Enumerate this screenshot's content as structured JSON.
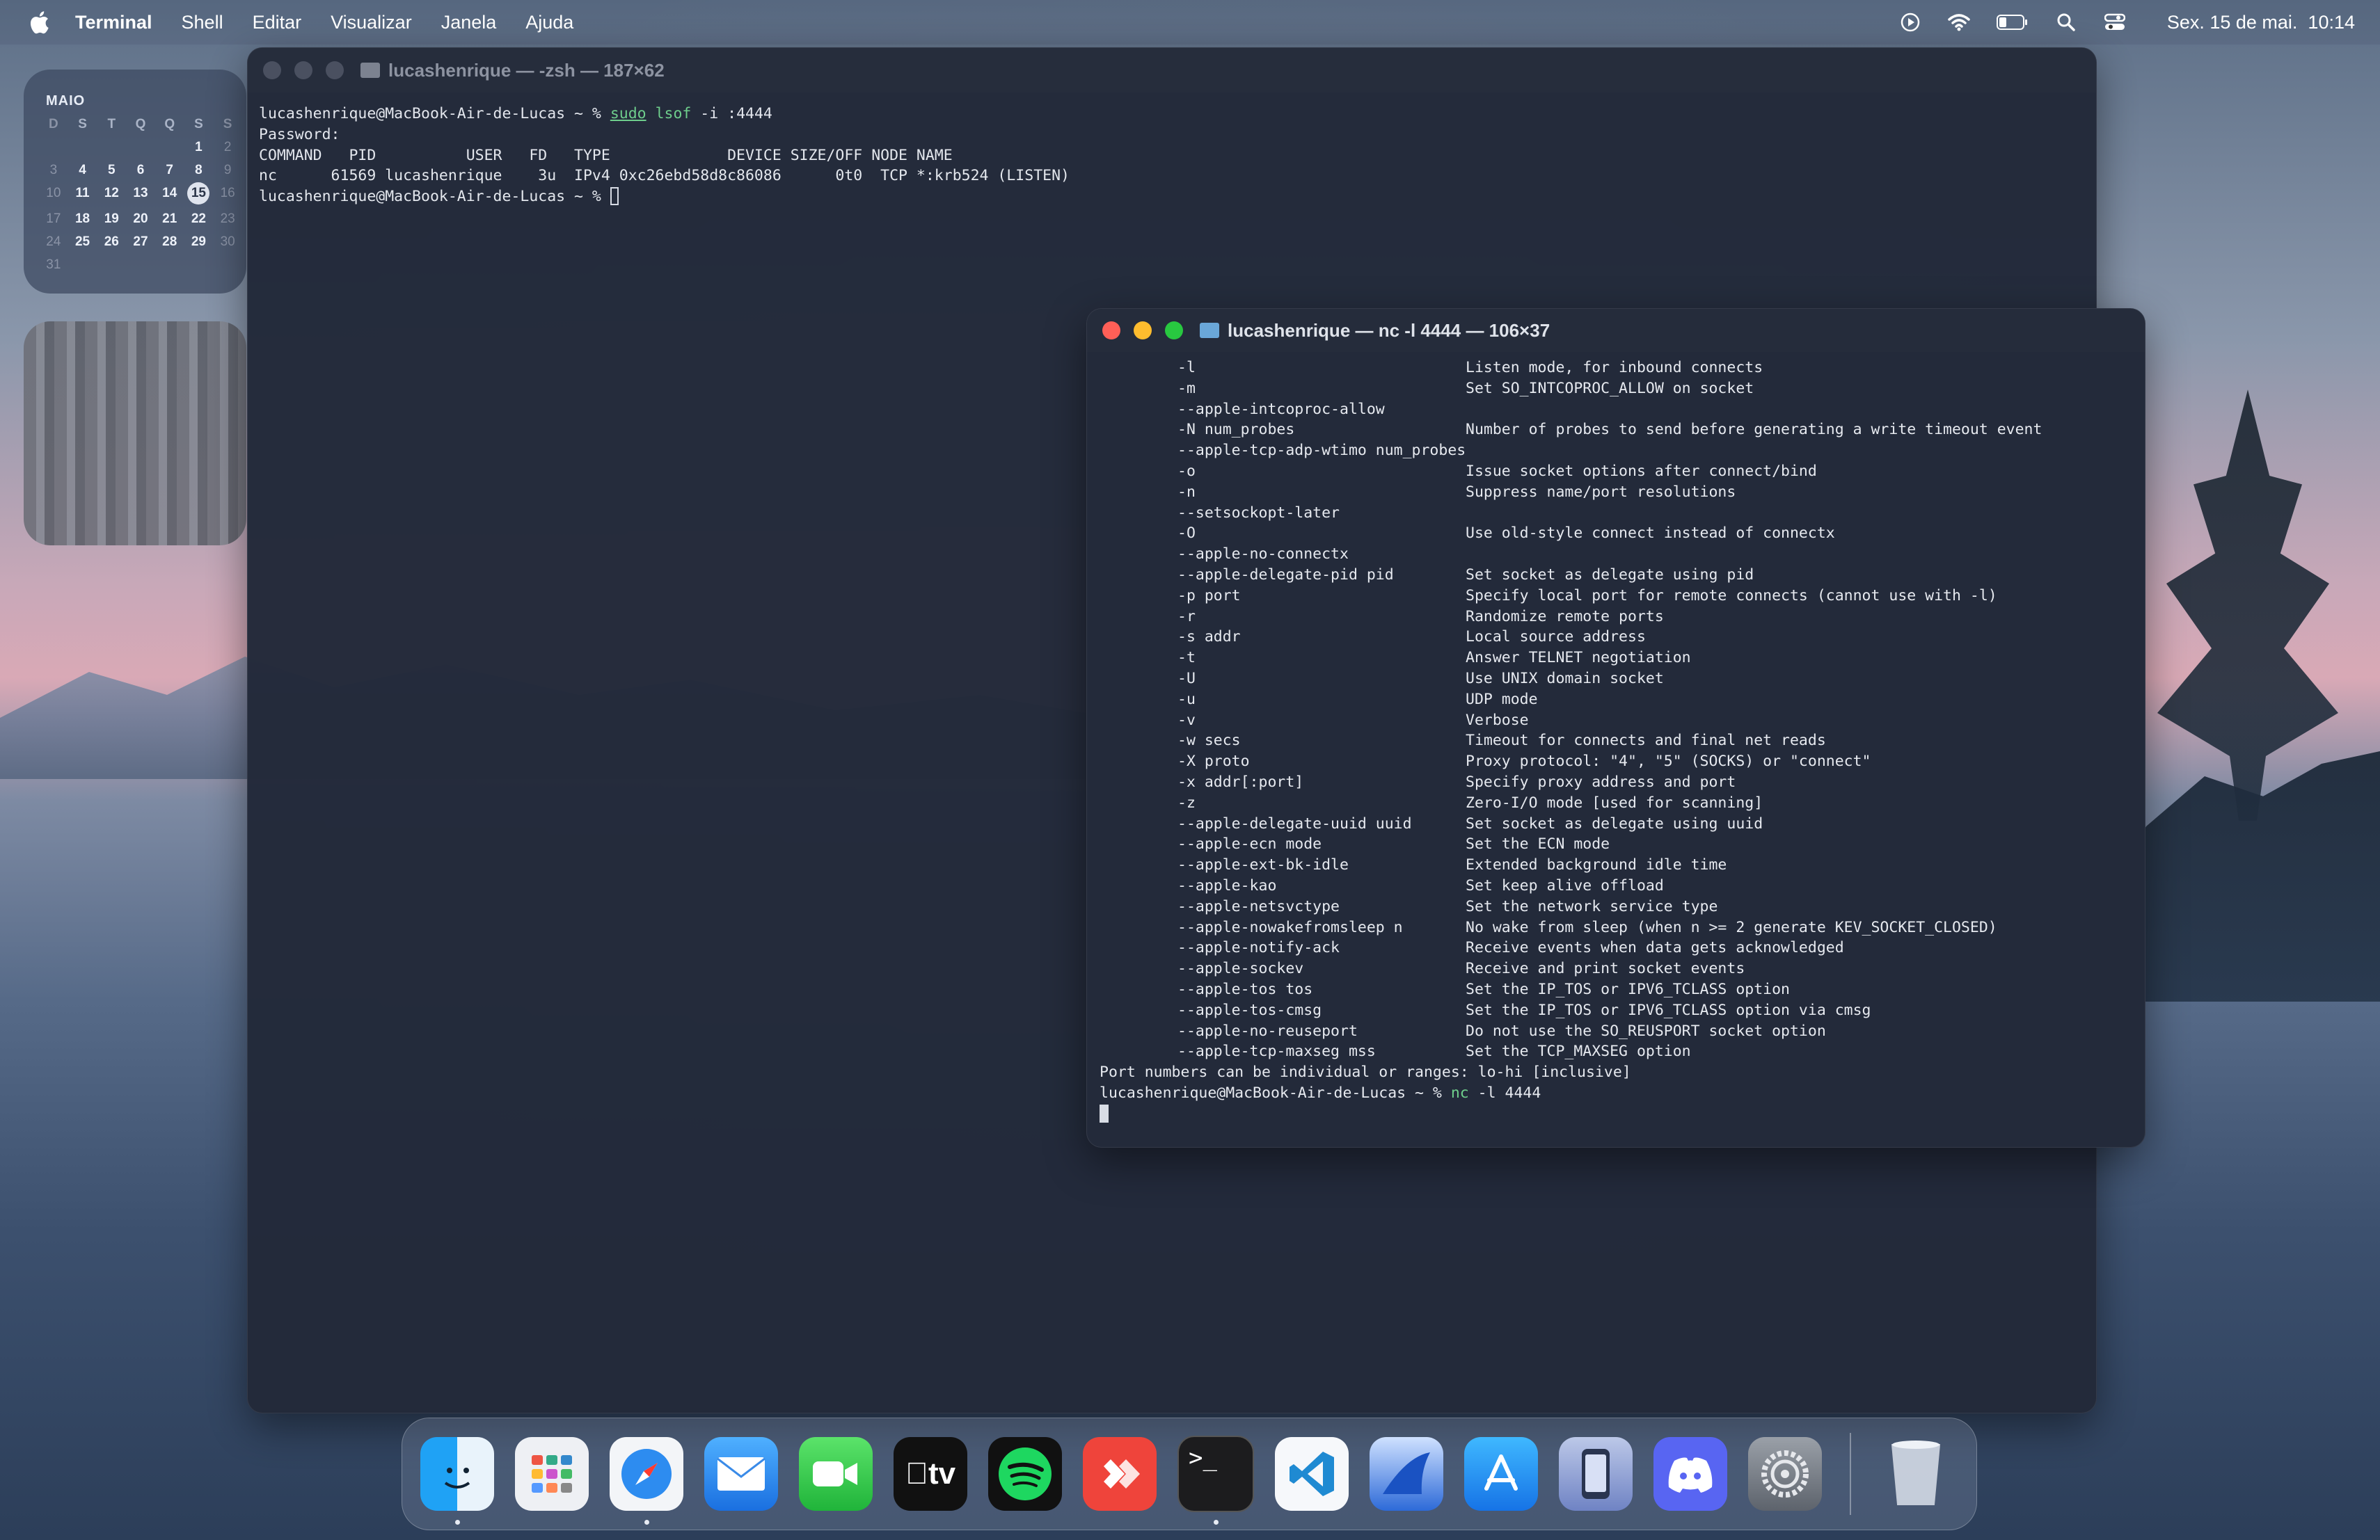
{
  "menubar": {
    "app_name": "Terminal",
    "menus": [
      "Shell",
      "Editar",
      "Visualizar",
      "Janela",
      "Ajuda"
    ],
    "status_icons": [
      "play-circle-icon",
      "wifi-icon",
      "battery-icon",
      "spotlight-search-icon",
      "control-center-icon"
    ],
    "clock": "Sex. 15 de mai.  10:14"
  },
  "calendar": {
    "month": "MAIO",
    "weekdays": [
      "D",
      "S",
      "T",
      "Q",
      "Q",
      "S",
      "S"
    ],
    "weeks": [
      [
        "",
        "",
        "",
        "",
        "",
        "1",
        "2"
      ],
      [
        "3",
        "4",
        "5",
        "6",
        "7",
        "8",
        "9"
      ],
      [
        "10",
        "11",
        "12",
        "13",
        "14",
        "15",
        "16"
      ],
      [
        "17",
        "18",
        "19",
        "20",
        "21",
        "22",
        "23"
      ],
      [
        "24",
        "25",
        "26",
        "27",
        "28",
        "29",
        "30"
      ],
      [
        "31",
        "",
        "",
        "",
        "",
        "",
        ""
      ]
    ],
    "today": "15"
  },
  "window_main": {
    "title": "lucashenrique — -zsh — 187×62",
    "lines": [
      {
        "prompt": "lucashenrique@MacBook-Air-de-Lucas ~ % ",
        "cmd": "sudo",
        "cmd2": "lsof",
        "rest": " -i :4444"
      },
      {
        "text": "Password:"
      },
      {
        "text": "COMMAND   PID          USER   FD   TYPE             DEVICE SIZE/OFF NODE NAME"
      },
      {
        "text": "nc      61569 lucashenrique    3u  IPv4 0xc26ebd58d8c86086      0t0  TCP *:krb524 (LISTEN)"
      },
      {
        "prompt": "lucashenrique@MacBook-Air-de-Lucas ~ % "
      }
    ]
  },
  "window_nc": {
    "title": "lucashenrique — nc -l 4444 — 106×37",
    "options": [
      [
        "-l",
        "Listen mode, for inbound connects"
      ],
      [
        "-m",
        "Set SO_INTCOPROC_ALLOW on socket"
      ],
      [
        "--apple-intcoproc-allow",
        ""
      ],
      [
        "-N num_probes",
        "Number of probes to send before generating a write timeout event"
      ],
      [
        "--apple-tcp-adp-wtimo num_probes",
        ""
      ],
      [
        "-o",
        "Issue socket options after connect/bind"
      ],
      [
        "-n",
        "Suppress name/port resolutions"
      ],
      [
        "--setsockopt-later",
        ""
      ],
      [
        "-O",
        "Use old-style connect instead of connectx"
      ],
      [
        "--apple-no-connectx",
        ""
      ],
      [
        "--apple-delegate-pid pid",
        "Set socket as delegate using pid"
      ],
      [
        "-p port",
        "Specify local port for remote connects (cannot use with -l)"
      ],
      [
        "-r",
        "Randomize remote ports"
      ],
      [
        "-s addr",
        "Local source address"
      ],
      [
        "-t",
        "Answer TELNET negotiation"
      ],
      [
        "-U",
        "Use UNIX domain socket"
      ],
      [
        "-u",
        "UDP mode"
      ],
      [
        "-v",
        "Verbose"
      ],
      [
        "-w secs",
        "Timeout for connects and final net reads"
      ],
      [
        "-X proto",
        "Proxy protocol: \"4\", \"5\" (SOCKS) or \"connect\""
      ],
      [
        "-x addr[:port]",
        "Specify proxy address and port"
      ],
      [
        "-z",
        "Zero-I/O mode [used for scanning]"
      ],
      [
        "--apple-delegate-uuid uuid",
        "Set socket as delegate using uuid"
      ],
      [
        "--apple-ecn mode",
        "Set the ECN mode"
      ],
      [
        "--apple-ext-bk-idle",
        "Extended background idle time"
      ],
      [
        "--apple-kao",
        "Set keep alive offload"
      ],
      [
        "--apple-netsvctype",
        "Set the network service type"
      ],
      [
        "--apple-nowakefromsleep n",
        "No wake from sleep (when n >= 2 generate KEV_SOCKET_CLOSED)"
      ],
      [
        "--apple-notify-ack",
        "Receive events when data gets acknowledged"
      ],
      [
        "--apple-sockev",
        "Receive and print socket events"
      ],
      [
        "--apple-tos tos",
        "Set the IP_TOS or IPV6_TCLASS option"
      ],
      [
        "--apple-tos-cmsg",
        "Set the IP_TOS or IPV6_TCLASS option via cmsg"
      ],
      [
        "--apple-no-reuseport",
        "Do not use the SO_REUSPORT socket option"
      ],
      [
        "--apple-tcp-maxseg mss",
        "Set the TCP_MAXSEG option"
      ]
    ],
    "footer": "Port numbers can be individual or ranges: lo-hi [inclusive]",
    "prompt": "lucashenrique@MacBook-Air-de-Lucas ~ % ",
    "prompt_cmd": "nc",
    "prompt_rest": " -l 4444"
  },
  "dock": {
    "apps": [
      {
        "name": "finder",
        "running": true
      },
      {
        "name": "launchpad",
        "running": false
      },
      {
        "name": "safari",
        "running": true
      },
      {
        "name": "mail",
        "running": false
      },
      {
        "name": "facetime",
        "running": false
      },
      {
        "name": "apple-tv",
        "running": false,
        "label": "tv"
      },
      {
        "name": "spotify",
        "running": false
      },
      {
        "name": "anydesk",
        "running": false
      },
      {
        "name": "terminal",
        "running": true,
        "label": ">_"
      },
      {
        "name": "vscode",
        "running": false
      },
      {
        "name": "wireshark",
        "running": false
      },
      {
        "name": "app-store",
        "running": false
      },
      {
        "name": "simulator",
        "running": false
      },
      {
        "name": "discord",
        "running": false
      },
      {
        "name": "system-settings",
        "running": false
      }
    ],
    "trash": "trash"
  },
  "colors": {
    "close": "#ff5f57",
    "minimize": "#febc2e",
    "zoom": "#28c840",
    "inactive_dot": "#4a5060",
    "command_green": "#6fd08c",
    "terminal_bg": "#232a3a"
  }
}
